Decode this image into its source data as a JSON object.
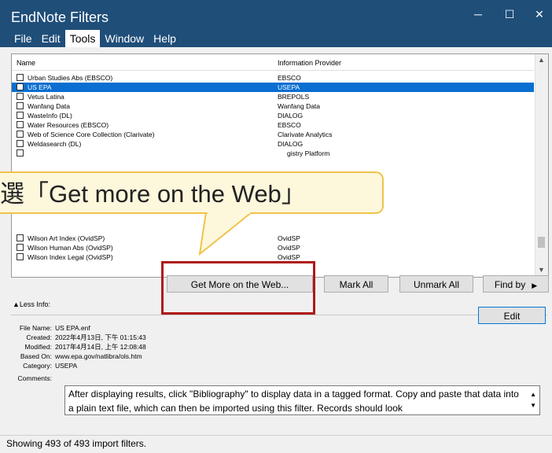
{
  "window": {
    "title": "EndNote Filters",
    "minimize": "─",
    "maximize": "☐",
    "close": "✕"
  },
  "menu": [
    {
      "label": "File"
    },
    {
      "label": "Edit"
    },
    {
      "label": "Tools"
    },
    {
      "label": "Window"
    },
    {
      "label": "Help"
    }
  ],
  "list": {
    "headers": {
      "name": "Name",
      "provider": "Information Provider"
    },
    "rows": [
      {
        "name": "Urban Studies Abs (EBSCO)",
        "provider": "EBSCO"
      },
      {
        "name": "US EPA",
        "provider": "USEPA"
      },
      {
        "name": "Vetus Latina",
        "provider": "BREPOLS"
      },
      {
        "name": "Wanfang Data",
        "provider": "Wanfang Data"
      },
      {
        "name": "WasteInfo (DL)",
        "provider": "DIALOG"
      },
      {
        "name": "Water Resources (EBSCO)",
        "provider": "EBSCO"
      },
      {
        "name": "Web of Science Core Collection (Clarivate)",
        "provider": "Clarivate Analytics"
      },
      {
        "name": "Weldasearch (DL)",
        "provider": "DIALOG"
      },
      {
        "name": "",
        "provider": "gistry Platform"
      },
      {
        "name": "Wilson Art Index (OvidSP)",
        "provider": "OvidSP"
      },
      {
        "name": "Wilson Human Abs (OvidSP)",
        "provider": "OvidSP"
      },
      {
        "name": "Wilson Index Legal (OvidSP)",
        "provider": "OvidSP"
      }
    ],
    "selected_name": "US EPA"
  },
  "callout": {
    "text": "選「Get more on the Web」"
  },
  "buttons": {
    "get_more": "Get More on the Web...",
    "mark_all": "Mark All",
    "unmark_all": "Unmark All",
    "find_by": "Find by",
    "edit": "Edit"
  },
  "less_info": "Less Info:",
  "details": {
    "file_name_label": "File Name:",
    "file_name": "US EPA.enf",
    "created_label": "Created:",
    "created": "2022年4月13日, 下午 01:15:43",
    "modified_label": "Modified:",
    "modified": "2017年4月14日, 上午 12:08:48",
    "based_on_label": "Based On:",
    "based_on": "www.epa.gov/natlibra/ols.htm",
    "category_label": "Category:",
    "category": "USEPA",
    "comments_label": "Comments:",
    "comments": "After displaying results, click \"Bibliography\" to display data in a tagged format.  Copy and paste that data into a plain text file, which can then be imported using this filter.  Records should look"
  },
  "status": "Showing 493 of 493 import filters.",
  "colors": {
    "titlebar": "#1f4e79",
    "selection": "#0a6fd1",
    "callout_fill": "#fdf7dc",
    "callout_border": "#f0c34a",
    "highlight": "#b01818",
    "edit_border": "#0078d7"
  }
}
